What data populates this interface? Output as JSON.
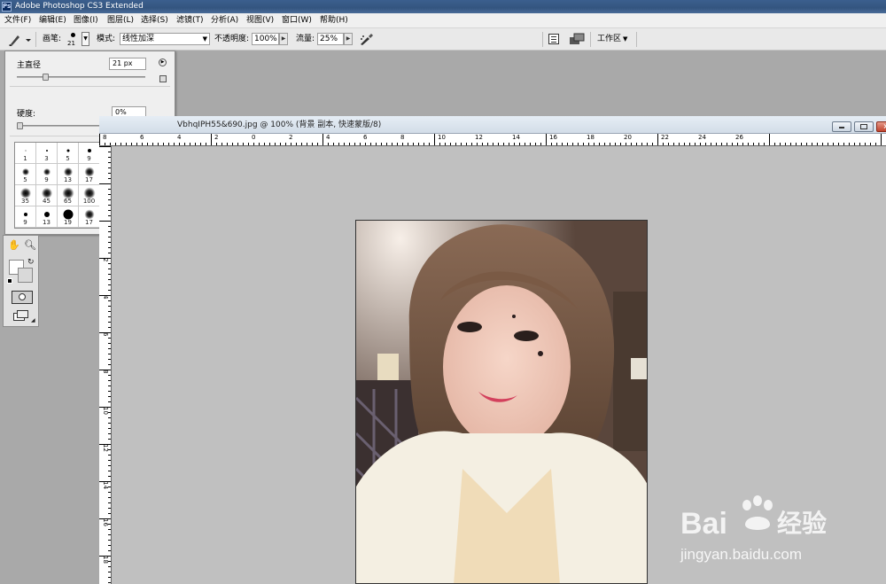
{
  "window": {
    "title": "Adobe Photoshop CS3 Extended",
    "app_icon": "Ps"
  },
  "menu": [
    "文件(F)",
    "编辑(E)",
    "图像(I)",
    "图层(L)",
    "选择(S)",
    "滤镜(T)",
    "分析(A)",
    "视图(V)",
    "窗口(W)",
    "帮助(H)"
  ],
  "options": {
    "brush_label": "画笔:",
    "brush_size": "21",
    "mode_label": "模式:",
    "mode_value": "线性加深",
    "opacity_label": "不透明度:",
    "opacity_value": "100%",
    "flow_label": "流量:",
    "flow_value": "25%",
    "workspace_label": "工作区"
  },
  "brush_panel": {
    "diameter_label": "主直径",
    "diameter_value": "21 px",
    "diameter_fraction": 0.1,
    "hardness_label": "硬度:",
    "hardness_value": "0%",
    "hardness_fraction": 0.0,
    "presets": [
      [
        "1",
        "3",
        "5",
        "9",
        "13",
        "19"
      ],
      [
        "5",
        "9",
        "13",
        "17",
        "21",
        "27"
      ],
      [
        "35",
        "45",
        "65",
        "100",
        "200",
        "300"
      ],
      [
        "9",
        "13",
        "19",
        "17",
        "45",
        "65"
      ]
    ],
    "selected_preset": "21"
  },
  "document": {
    "title": "VbhqIPH55&690.jpg @ 100% (背景 副本, 快速蒙版/8)",
    "hruler_labels": [
      "8",
      "6",
      "4",
      "2",
      "0",
      "2",
      "4",
      "6",
      "8",
      "10",
      "12",
      "14",
      "16",
      "18",
      "20",
      "22",
      "24",
      "26"
    ],
    "vruler_labels": [
      "2",
      "4",
      "6",
      "8",
      "10",
      "12",
      "14",
      "16",
      "18"
    ]
  },
  "watermark": {
    "brand": "Bai",
    "brand2": "经验",
    "url": "jingyan.baidu.com"
  }
}
